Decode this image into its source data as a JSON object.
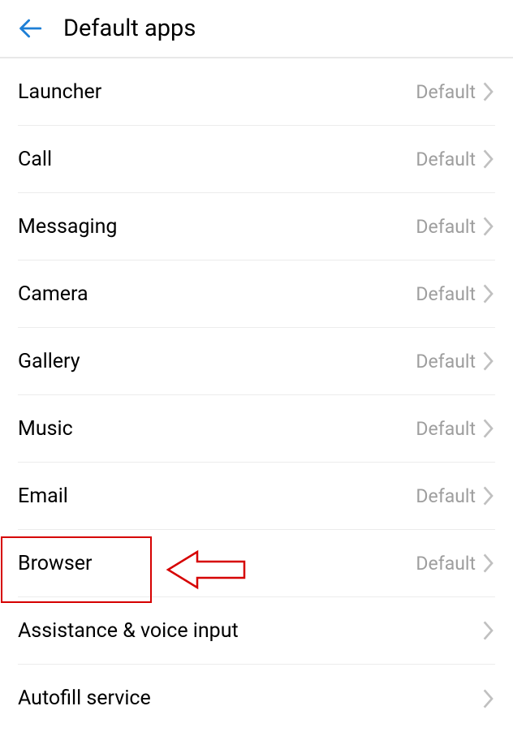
{
  "header": {
    "title": "Default apps"
  },
  "items": [
    {
      "label": "Launcher",
      "value": "Default"
    },
    {
      "label": "Call",
      "value": "Default"
    },
    {
      "label": "Messaging",
      "value": "Default"
    },
    {
      "label": "Camera",
      "value": "Default"
    },
    {
      "label": "Gallery",
      "value": "Default"
    },
    {
      "label": "Music",
      "value": "Default"
    },
    {
      "label": "Email",
      "value": "Default"
    },
    {
      "label": "Browser",
      "value": "Default"
    },
    {
      "label": "Assistance & voice input",
      "value": ""
    },
    {
      "label": "Autofill service",
      "value": ""
    }
  ]
}
